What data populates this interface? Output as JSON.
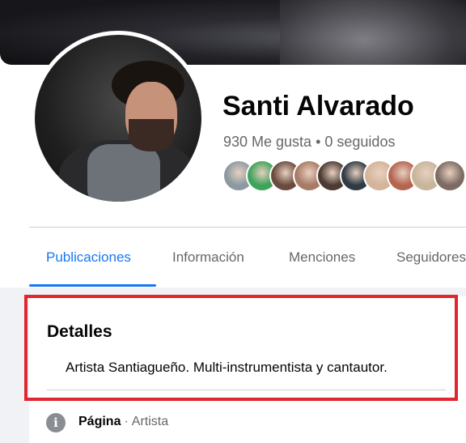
{
  "profile": {
    "name": "Santi Alvarado",
    "likes": "930 Me gusta",
    "separator": "•",
    "following": "0 seguidos"
  },
  "friend_avatars": [
    {
      "color": "#8b9aa1"
    },
    {
      "color": "#3fa35b"
    },
    {
      "color": "#6b4b3e"
    },
    {
      "color": "#a87b66"
    },
    {
      "color": "#4c3a33"
    },
    {
      "color": "#2f3a44"
    },
    {
      "color": "#d4b49a"
    },
    {
      "color": "#b5654f"
    },
    {
      "color": "#c8b59a"
    },
    {
      "color": "#7d6b63"
    }
  ],
  "tabs": [
    {
      "label": "Publicaciones",
      "active": true
    },
    {
      "label": "Información",
      "active": false
    },
    {
      "label": "Menciones",
      "active": false
    },
    {
      "label": "Seguidores",
      "active": false
    }
  ],
  "details": {
    "title": "Detalles",
    "description": "Artista Santiagueño. Multi-instrumentista y cantautor.",
    "category_label": "Página",
    "category_sep": "·",
    "category_value": "Artista",
    "info_icon": "info-icon"
  },
  "colors": {
    "accent": "#1877f2",
    "highlight_border": "#e0262f",
    "secondary_text": "#65676b"
  }
}
